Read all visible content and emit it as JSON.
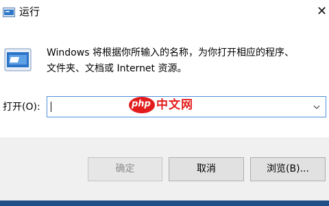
{
  "window": {
    "title": "运行"
  },
  "description": {
    "line1": "Windows 将根据你所输入的名称，为你打开相应的程序、",
    "line2": "文件夹、文档或 Internet 资源。"
  },
  "open": {
    "label": "打开(O):",
    "value": ""
  },
  "watermark": {
    "php": "php",
    "cn": "中文网"
  },
  "buttons": {
    "ok": "确定",
    "cancel": "取消",
    "browse": "浏览(B)..."
  },
  "colors": {
    "accent_border": "#4a90d9",
    "watermark_red": "#e21c1c",
    "taskbar": "#1f4f86"
  },
  "icons": {
    "title": "run-icon",
    "app": "run-app-icon",
    "close": "close-icon",
    "dropdown": "chevron-down-icon"
  }
}
